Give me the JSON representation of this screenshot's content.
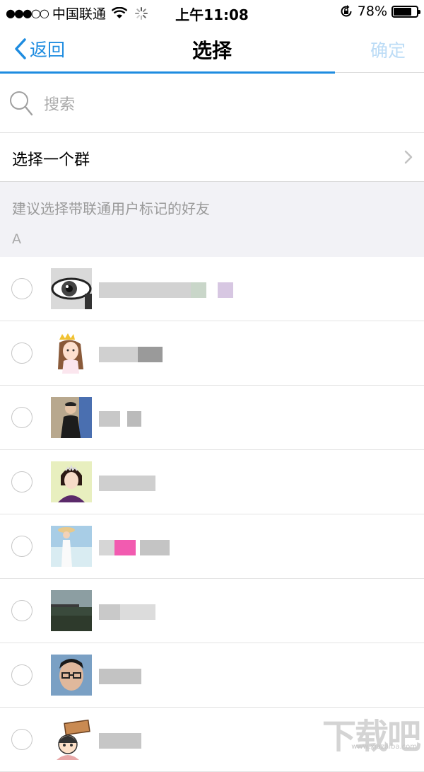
{
  "status_bar": {
    "signal": "●●●○○",
    "carrier": "中国联通",
    "time": "上午11:08",
    "battery": "78%",
    "battery_level": 0.78
  },
  "nav": {
    "back_label": "返回",
    "title": "选择",
    "confirm_label": "确定",
    "progress": 0.79,
    "accent_color": "#1e8ce0"
  },
  "search": {
    "placeholder": "搜索"
  },
  "group_select": {
    "label": "选择一个群"
  },
  "suggestion": {
    "text": "建议选择带联通用户标记的好友",
    "section_letter": "A"
  },
  "contacts": [
    {
      "name": "",
      "avatar": "eye-avatar"
    },
    {
      "name": "",
      "avatar": "princess-cartoon-avatar"
    },
    {
      "name": "",
      "avatar": "man-photo-avatar"
    },
    {
      "name": "",
      "avatar": "woman-tiara-avatar"
    },
    {
      "name": "",
      "avatar": "beach-girl-avatar"
    },
    {
      "name": "",
      "avatar": "landscape-avatar"
    },
    {
      "name": "",
      "avatar": "man-glasses-avatar"
    },
    {
      "name": "",
      "avatar": "cartoon-sign-avatar"
    }
  ],
  "watermark": {
    "text": "下载吧",
    "url": "www.xiazaiba.com"
  }
}
